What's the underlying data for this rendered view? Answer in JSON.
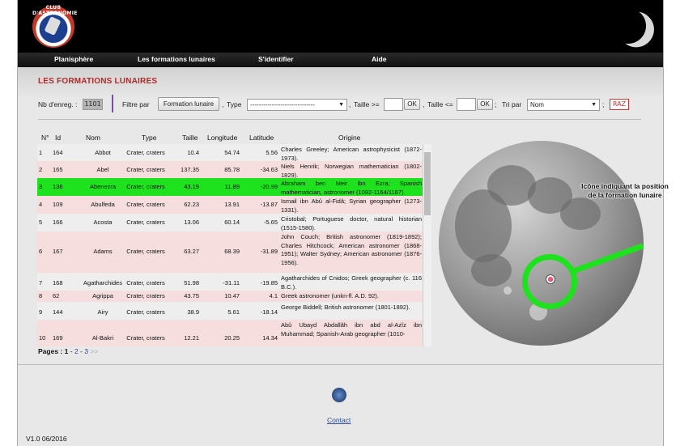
{
  "logo": {
    "text": "CLUB D'ASTRONOMIE"
  },
  "nav": [
    "Planisphère",
    "Les formations lunaires",
    "S'identifier",
    "Aide"
  ],
  "page_title": "LES FORMATIONS LUNAIRES",
  "controls": {
    "count_label": "Nb d'enreg. :",
    "count_value": "1101",
    "filter_label": "Filtre par",
    "filter_button": "Formation lunaire",
    "comma1": ",",
    "type_label": "Type",
    "type_value": "------------------------------",
    "comma2": ",",
    "size_min_label": "Taille >=",
    "ok1": "OK",
    "comma3": ",",
    "size_max_label": "Taille <=",
    "ok2": "OK",
    "semicolon1": ";",
    "sort_label": "Tri par",
    "sort_value": "Nom",
    "semicolon2": ";",
    "reset": "RAZ"
  },
  "table": {
    "headers": [
      "N°",
      "Id",
      "Nom",
      "Type",
      "Taille",
      "Longitude",
      "Latitude",
      "Origine"
    ],
    "rows": [
      {
        "n": "1",
        "id": "164",
        "nom": "Abbot",
        "type": "Crater, craters",
        "taille": "10.4",
        "lon": "54.74",
        "lat": "5.56",
        "orig": "Charles Greeley; American astrophysicist (1872-1973).",
        "bg": "#eeeeee"
      },
      {
        "n": "2",
        "id": "165",
        "nom": "Abel",
        "type": "Crater, craters",
        "taille": "137.35",
        "lon": "85.78",
        "lat": "-34.63",
        "orig": "Niels Henrik; Norwegian mathematician (1802-1829).",
        "bg": "#f6dede"
      },
      {
        "n": "3",
        "id": "136",
        "nom": "Abenezra",
        "type": "Crater, craters",
        "taille": "43.19",
        "lon": "11.89",
        "lat": "-20.99",
        "orig": "Abraham ben Meir ibn Ezra; Spanish mathematician, astronomer (1092-1164/1167).",
        "bg": "#1ee21e"
      },
      {
        "n": "4",
        "id": "109",
        "nom": "Abulfeda",
        "type": "Crater, craters",
        "taille": "62.23",
        "lon": "13.91",
        "lat": "-13.87",
        "orig": "Ismail ibn Abû al-Fidâ; Syrian geographer (1273-1331).",
        "bg": "#f6dede"
      },
      {
        "n": "5",
        "id": "166",
        "nom": "Acosta",
        "type": "Crater, craters",
        "taille": "13.06",
        "lon": "60.14",
        "lat": "-5.65",
        "orig": "Cristobal; Portuguese doctor, natural historian (1515-1580).",
        "bg": "#eeeeee"
      },
      {
        "n": "6",
        "id": "167",
        "nom": "Adams",
        "type": "Crater, craters",
        "taille": "63.27",
        "lon": "68.39",
        "lat": "-31.89",
        "orig": "John Couch; British astronomer (1819-1892); Charles Hitchcock; American astronomer (1868-1951); Walter Sydney; American astronomer (1876-1956).",
        "bg": "#f6dede"
      },
      {
        "n": "7",
        "id": "168",
        "nom": "Agatharchides",
        "type": "Crater, craters",
        "taille": "51.98",
        "lon": "-31.11",
        "lat": "-19.85",
        "orig": "Agatharchides of Cnidos; Greek geographer (c. 116 B.C.).",
        "bg": "#eeeeee"
      },
      {
        "n": "8",
        "id": "62",
        "nom": "Agrippa",
        "type": "Crater, craters",
        "taille": "43.75",
        "lon": "10.47",
        "lat": "4.1",
        "orig": "Greek astronomer (unkn-fl. A.D. 92).",
        "bg": "#f6dede"
      },
      {
        "n": "9",
        "id": "144",
        "nom": "Airy",
        "type": "Crater, craters",
        "taille": "38.9",
        "lon": "5.61",
        "lat": "-18.14",
        "orig": "George Biddell; British astronomer (1801-1892).",
        "bg": "#eeeeee"
      },
      {
        "n": "10",
        "id": "169",
        "nom": "Al-Bakri",
        "type": "Crater, craters",
        "taille": "12.21",
        "lon": "20.25",
        "lat": "14.34",
        "orig": "Abû Ubayd Abdallâh ibn abd al-Azîz ibn Muhammad; Spanish-Arab geographer (1010-",
        "bg": "#f6dede"
      }
    ]
  },
  "pagination": {
    "label": "Pages :",
    "current": "1",
    "sep1": "-",
    "p2": "2",
    "sep2": "-",
    "p3": "3",
    "next": ">>"
  },
  "annotation": "Icône indiquant la position de la formation lunaire",
  "footer": {
    "contact": "Contact",
    "version": "V1.0 06/2016"
  }
}
